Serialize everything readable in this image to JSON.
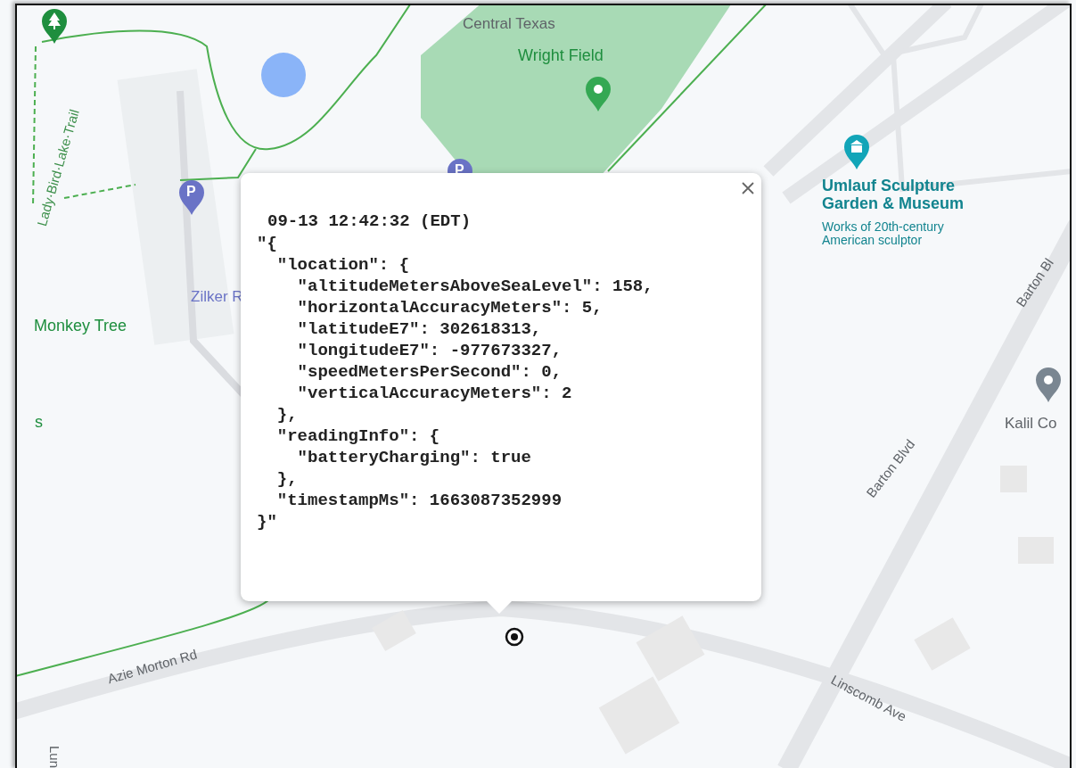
{
  "map_labels": [
    {
      "text": "Lady·Bird·Lake·Trail",
      "kind": "trail"
    },
    {
      "text": "Zilker R",
      "kind": "parking"
    },
    {
      "text": "Monkey Tree",
      "kind": "park"
    },
    {
      "text": "s",
      "kind": "park"
    },
    {
      "text": "Central Texas",
      "kind": "poi"
    },
    {
      "text": "Wright Field",
      "kind": "park"
    },
    {
      "text": "Umlauf Sculpture Garden & Museum",
      "kind": "museum"
    },
    {
      "text": "Works of 20th-century American sculptor",
      "kind": "museum-note"
    },
    {
      "text": "Barton Bl",
      "kind": "street"
    },
    {
      "text": "Kalil Co",
      "kind": "poi"
    },
    {
      "text": "Barton Blvd",
      "kind": "street"
    },
    {
      "text": "Azie Morton Rd",
      "kind": "street"
    },
    {
      "text": "Linscomb Ave",
      "kind": "street"
    },
    {
      "text": "Lun",
      "kind": "street"
    }
  ],
  "pins": [
    {
      "kind": "tree"
    },
    {
      "kind": "parking",
      "label": "P"
    },
    {
      "kind": "parking",
      "label": "P"
    },
    {
      "kind": "place"
    },
    {
      "kind": "museum"
    },
    {
      "kind": "grey"
    },
    {
      "kind": "location"
    }
  ],
  "popup": {
    "timestamp": "09-13 12:42:32 (EDT)",
    "lines": [
      "\"{",
      "  \"location\": {",
      "    \"altitudeMetersAboveSeaLevel\": 158,",
      "    \"horizontalAccuracyMeters\": 5,",
      "    \"latitudeE7\": 302618313,",
      "    \"longitudeE7\": -977673327,",
      "    \"speedMetersPerSecond\": 0,",
      "    \"verticalAccuracyMeters\": 2",
      "  },",
      "  \"readingInfo\": {",
      "    \"batteryCharging\": true",
      "  },",
      "  \"timestampMs\": 1663087352999",
      "}\""
    ]
  }
}
